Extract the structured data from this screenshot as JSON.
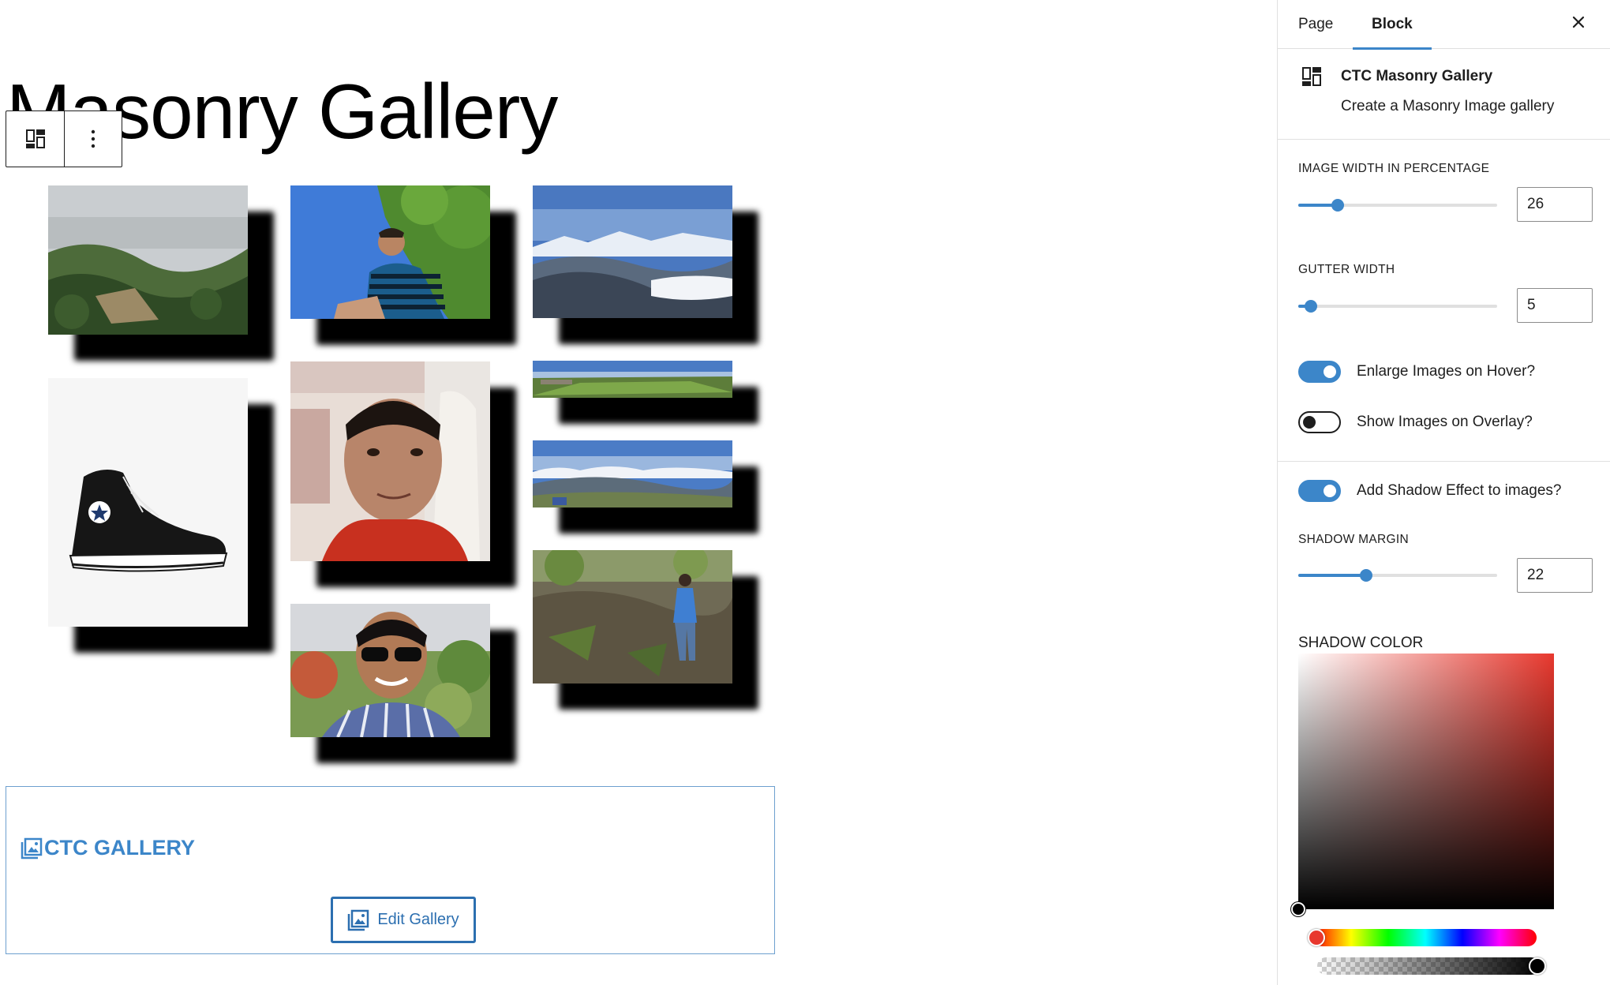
{
  "editor": {
    "page_title": "Masonry Gallery",
    "toolbar": {
      "block_icon": "masonry-grid-icon",
      "more_icon": "more-vertical-icon"
    }
  },
  "gallery": {
    "images": [
      {
        "name": "gallery-image-forest-hills",
        "subject": "forest-hills"
      },
      {
        "name": "gallery-image-man-blue-sky",
        "subject": "man-blue-sky"
      },
      {
        "name": "gallery-image-snow-mountains",
        "subject": "snow-mountains"
      },
      {
        "name": "gallery-image-sneaker",
        "subject": "sneaker"
      },
      {
        "name": "gallery-image-selfie",
        "subject": "selfie"
      },
      {
        "name": "gallery-image-panorama-valley",
        "subject": "panorama-valley"
      },
      {
        "name": "gallery-image-panorama-hills",
        "subject": "panorama-hills"
      },
      {
        "name": "gallery-image-man-sunglasses",
        "subject": "man-sunglasses"
      },
      {
        "name": "gallery-image-man-slope",
        "subject": "man-slope"
      }
    ]
  },
  "ctc_block": {
    "title": "CTC GALLERY",
    "edit_button": "Edit Gallery"
  },
  "sidebar": {
    "tabs": [
      {
        "label": "Page",
        "active": false
      },
      {
        "label": "Block",
        "active": true
      }
    ],
    "block_card": {
      "title": "CTC Masonry Gallery",
      "description": "Create a Masonry Image gallery"
    },
    "image_width": {
      "label": "IMAGE WIDTH IN PERCENTAGE",
      "value": "26",
      "fraction": 0.2
    },
    "gutter_width": {
      "label": "GUTTER WIDTH",
      "value": "5",
      "fraction": 0.065
    },
    "enlarge_toggle": {
      "label": "Enlarge Images on Hover?",
      "on": true
    },
    "overlay_toggle": {
      "label": "Show Images on Overlay?",
      "on": false
    },
    "shadow_toggle": {
      "label": "Add Shadow Effect to images?",
      "on": true
    },
    "shadow_margin": {
      "label": "SHADOW MARGIN",
      "value": "22",
      "fraction": 0.34
    },
    "shadow_color": {
      "label": "SHADOW COLOR",
      "value": "#000000",
      "hue": "#e8382e"
    }
  },
  "colors": {
    "accent": "#3c86c9",
    "ctc_blue": "#3c86c9",
    "edit_button_border": "#2c6fb0"
  }
}
